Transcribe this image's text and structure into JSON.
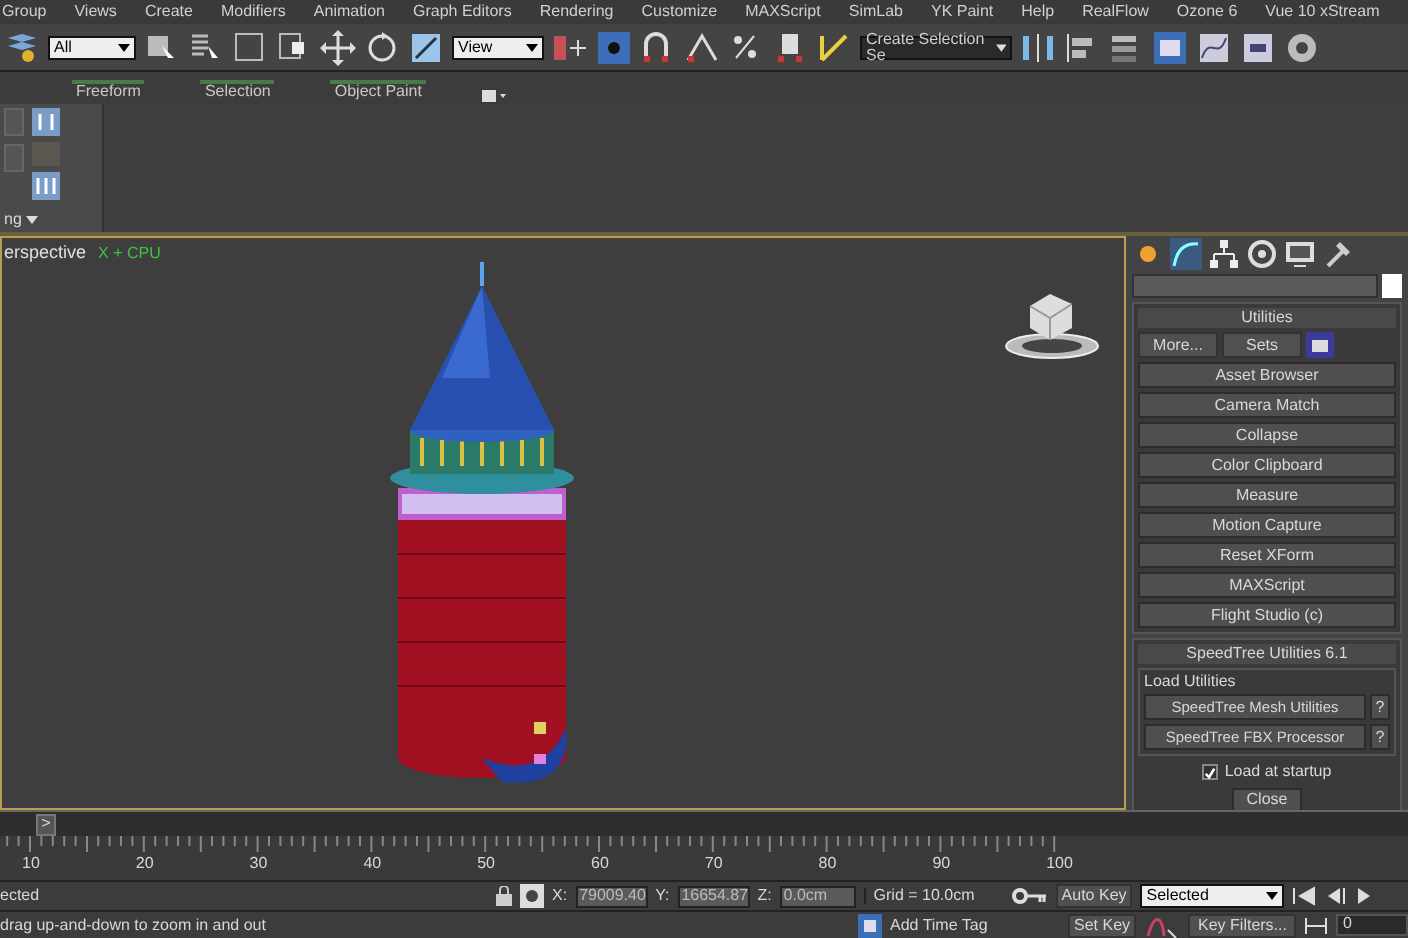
{
  "menu_bar": [
    "Group",
    "Views",
    "Create",
    "Modifiers",
    "Animation",
    "Graph Editors",
    "Rendering",
    "Customize",
    "MAXScript",
    "SimLab",
    "YK Paint",
    "Help",
    "RealFlow",
    "Ozone 6",
    "Vue 10 xStream"
  ],
  "toolbar": {
    "selection_filter": "All",
    "reference_coordinate": "View",
    "named_selection": "Create Selection Se"
  },
  "ribbon": {
    "tabs": [
      "Freeform",
      "Selection",
      "Object Paint"
    ],
    "panel_dropdown": "ng"
  },
  "viewport": {
    "label": "erspective",
    "stats": "X + CPU"
  },
  "command_panel": {
    "rollout_title": "Utilities",
    "more_button": "More...",
    "sets_button": "Sets",
    "utilities": [
      "Asset Browser",
      "Camera Match",
      "Collapse",
      "Color Clipboard",
      "Measure",
      "Motion Capture",
      "Reset XForm",
      "MAXScript",
      "Flight Studio (c)"
    ],
    "speedtree": {
      "title": "SpeedTree Utilities 6.1",
      "group_label": "Load Utilities",
      "buttons": [
        {
          "label": "SpeedTree Mesh Utilities",
          "help": "?"
        },
        {
          "label": "SpeedTree FBX Processor",
          "help": "?"
        }
      ],
      "load_at_startup": {
        "label": "Load at startup",
        "checked": true
      },
      "close_button": "Close"
    }
  },
  "timeline": {
    "slider_button": ">",
    "ruler_labels": [
      "10",
      "20",
      "30",
      "40",
      "50",
      "60",
      "70",
      "80",
      "90",
      "100"
    ]
  },
  "status_bar": {
    "selection_text": "ected",
    "x_label": "X:",
    "x_value": "79009.40",
    "y_label": "Y:",
    "y_value": "16654.87",
    "z_label": "Z:",
    "z_value": "0.0cm",
    "grid": "Grid = 10.0cm",
    "auto_key": "Auto Key",
    "key_mode": "Selected",
    "set_key": "Set Key",
    "key_filters": "Key Filters...",
    "frame": "0"
  },
  "prompt": {
    "text": "drag up-and-down to zoom in and out",
    "add_time_tag": "Add Time Tag"
  }
}
